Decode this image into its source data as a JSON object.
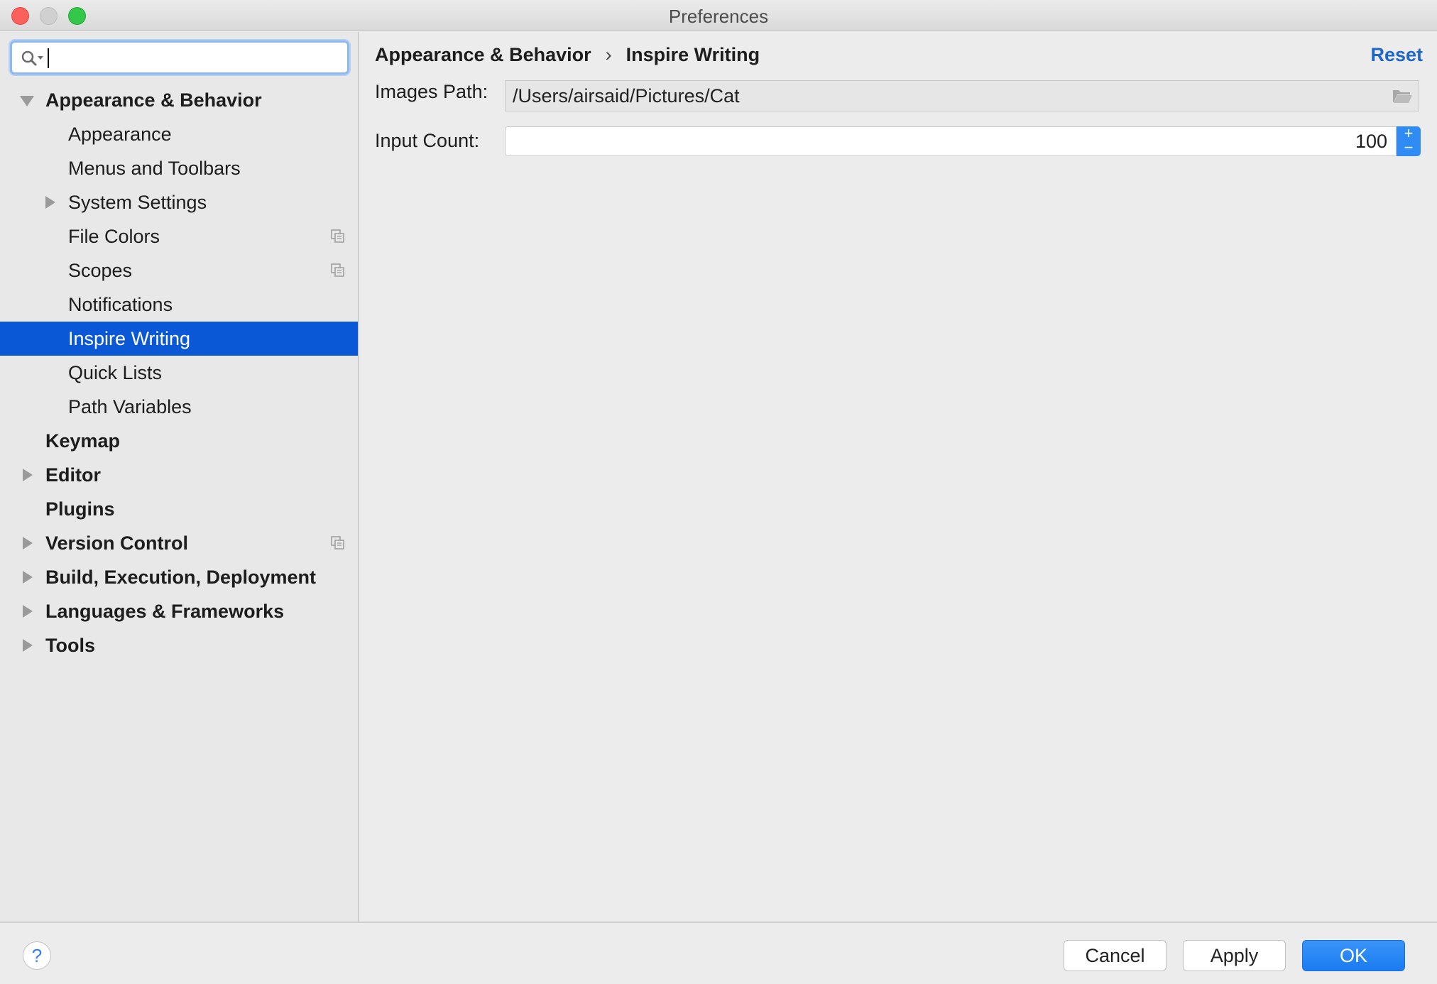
{
  "window": {
    "title": "Preferences"
  },
  "search": {
    "value": "",
    "placeholder": ""
  },
  "tree": [
    {
      "label": "Appearance & Behavior",
      "level": 0,
      "bold": true,
      "expander": "down",
      "copy_icon": false,
      "selected": false
    },
    {
      "label": "Appearance",
      "level": 1,
      "bold": false,
      "expander": "none",
      "copy_icon": false,
      "selected": false
    },
    {
      "label": "Menus and Toolbars",
      "level": 1,
      "bold": false,
      "expander": "none",
      "copy_icon": false,
      "selected": false
    },
    {
      "label": "System Settings",
      "level": 1,
      "bold": false,
      "expander": "right",
      "copy_icon": false,
      "selected": false
    },
    {
      "label": "File Colors",
      "level": 1,
      "bold": false,
      "expander": "none",
      "copy_icon": true,
      "selected": false
    },
    {
      "label": "Scopes",
      "level": 1,
      "bold": false,
      "expander": "none",
      "copy_icon": true,
      "selected": false
    },
    {
      "label": "Notifications",
      "level": 1,
      "bold": false,
      "expander": "none",
      "copy_icon": false,
      "selected": false
    },
    {
      "label": "Inspire Writing",
      "level": 1,
      "bold": false,
      "expander": "none",
      "copy_icon": false,
      "selected": true
    },
    {
      "label": "Quick Lists",
      "level": 1,
      "bold": false,
      "expander": "none",
      "copy_icon": false,
      "selected": false
    },
    {
      "label": "Path Variables",
      "level": 1,
      "bold": false,
      "expander": "none",
      "copy_icon": false,
      "selected": false
    },
    {
      "label": "Keymap",
      "level": 0,
      "bold": true,
      "expander": "none",
      "copy_icon": false,
      "selected": false
    },
    {
      "label": "Editor",
      "level": 0,
      "bold": true,
      "expander": "right",
      "copy_icon": false,
      "selected": false
    },
    {
      "label": "Plugins",
      "level": 0,
      "bold": true,
      "expander": "none",
      "copy_icon": false,
      "selected": false
    },
    {
      "label": "Version Control",
      "level": 0,
      "bold": true,
      "expander": "right",
      "copy_icon": true,
      "selected": false
    },
    {
      "label": "Build, Execution, Deployment",
      "level": 0,
      "bold": true,
      "expander": "right",
      "copy_icon": false,
      "selected": false
    },
    {
      "label": "Languages & Frameworks",
      "level": 0,
      "bold": true,
      "expander": "right",
      "copy_icon": false,
      "selected": false
    },
    {
      "label": "Tools",
      "level": 0,
      "bold": true,
      "expander": "right",
      "copy_icon": false,
      "selected": false
    }
  ],
  "main": {
    "breadcrumb": {
      "parent": "Appearance & Behavior",
      "separator": "›",
      "current": "Inspire Writing"
    },
    "reset_label": "Reset",
    "images_path": {
      "label": "Images Path:",
      "value": "/Users/airsaid/Pictures/Cat"
    },
    "input_count": {
      "label": "Input Count:",
      "value": "100",
      "plus": "+",
      "minus": "−"
    }
  },
  "footer": {
    "help_label": "?",
    "cancel_label": "Cancel",
    "apply_label": "Apply",
    "ok_label": "OK"
  },
  "colors": {
    "selection": "#0a58d6",
    "accent_link": "#1e66c7",
    "primary_button": "#1a7cf2"
  }
}
